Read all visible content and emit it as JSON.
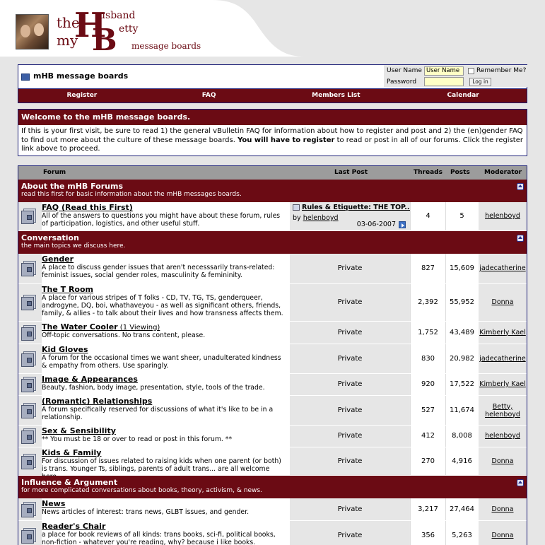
{
  "header": {
    "logo": {
      "the": "the",
      "my": "my",
      "h": "H",
      "b": "B",
      "usband": "usband",
      "etty": "etty"
    },
    "tagline": "message boards"
  },
  "navbar": {
    "board_title": "mHB message boards",
    "login": {
      "username_label": "User Name",
      "username_value": "User Name",
      "password_label": "Password",
      "remember_label": "Remember Me?",
      "login_button": "Log in"
    },
    "links": [
      "Register",
      "FAQ",
      "Members List",
      "Calendar"
    ]
  },
  "welcome": {
    "title": "Welcome to the mHB message boards.",
    "text_1": "If this is your first visit, be sure to read 1) the general ",
    "link_1": "vBulletin FAQ",
    "text_2": " for information about how to register and post and 2) the ",
    "link_2": "(en)gender FAQ",
    "text_3": " to find out more about the culture of these message boards. ",
    "bold": "You will have to register",
    "text_4": " to read or post in all of our forums. Click the register link above to proceed."
  },
  "table": {
    "headers": {
      "forum": "Forum",
      "last_post": "Last Post",
      "threads": "Threads",
      "posts": "Posts",
      "moderator": "Moderator"
    }
  },
  "categories": [
    {
      "title": "About the mHB Forums",
      "desc": "read this first for basic information about the mHB messages boards."
    },
    {
      "title": "Conversation",
      "desc": "the main topics we discuss here."
    },
    {
      "title": "Influence & Argument",
      "desc": "for more complicated conversations about books, theory, activism, & news."
    }
  ],
  "forums": [
    {
      "title": "FAQ (Read this First)",
      "desc": "All of the answers to questions you might have about these forum, rules of participation, logistics, and other useful stuff.",
      "last_post_title": "Rules & Etiquette: THE TOP...",
      "last_post_by": "by ",
      "last_post_user": "helenboyd",
      "last_post_date": "03-06-2007",
      "threads": "4",
      "posts": "5",
      "moderator": "helenboyd"
    },
    {
      "title": "Gender",
      "desc": "A place to discuss gender issues that aren't necesssarily trans-related: feminist issues, social gender roles, masculinity & femininity.",
      "last_post": "Private",
      "threads": "827",
      "posts": "15,609",
      "moderator": "jadecatherine"
    },
    {
      "title": "The T Room",
      "desc": "A place for various stripes of T folks - CD, TV, TG, TS, genderqueer, androgyne, DQ, boi, whathaveyou - as well as significant others, friends, family, & allies - to talk about their lives and how transness affects them.",
      "last_post": "Private",
      "threads": "2,392",
      "posts": "55,952",
      "moderator": "Donna"
    },
    {
      "title": "The Water Cooler",
      "viewing": " (1 Viewing)",
      "desc": "Off-topic conversations. No trans content, please.",
      "last_post": "Private",
      "threads": "1,752",
      "posts": "43,489",
      "moderator": "Kimberly Kael"
    },
    {
      "title": "Kid Gloves",
      "desc": "A forum for the occasional times we want sheer, unadulterated kindness & empathy from others. Use sparingly.",
      "last_post": "Private",
      "threads": "830",
      "posts": "20,982",
      "moderator": "jadecatherine"
    },
    {
      "title": "Image & Appearances",
      "desc": "Beauty, fashion, body image, presentation, style, tools of the trade.",
      "last_post": "Private",
      "threads": "920",
      "posts": "17,522",
      "moderator": "Kimberly Kael"
    },
    {
      "title": "(Romantic) Relationships",
      "desc": "A forum specifically reserved for discussions of what it's like to be in a relationship.",
      "last_post": "Private",
      "threads": "527",
      "posts": "11,674",
      "moderator": "Betty,",
      "moderator_2": "helenboyd"
    },
    {
      "title": "Sex & Sensibility",
      "desc": "** You must be 18 or over to read or post in this forum. **",
      "last_post": "Private",
      "threads": "412",
      "posts": "8,008",
      "moderator": "helenboyd"
    },
    {
      "title": "Kids & Family",
      "desc": "For discussion of issues related to raising kids when one parent (or both) is trans. Younger Ts, siblings, parents of adult trans... are all welcome here.",
      "last_post": "Private",
      "threads": "270",
      "posts": "4,916",
      "moderator": "Donna"
    },
    {
      "title": "News",
      "desc": "News articles of interest: trans news, GLBT issues, and gender.",
      "last_post": "Private",
      "threads": "3,217",
      "posts": "27,464",
      "moderator": "Donna"
    },
    {
      "title": "Reader's Chair",
      "desc": "a place for book reviews of all kinds: trans books, sci-fi, political books, non-fiction - whatever you're reading, why? because i like books.",
      "last_post": "Private",
      "threads": "356",
      "posts": "5,263",
      "moderator": "Donna"
    }
  ]
}
